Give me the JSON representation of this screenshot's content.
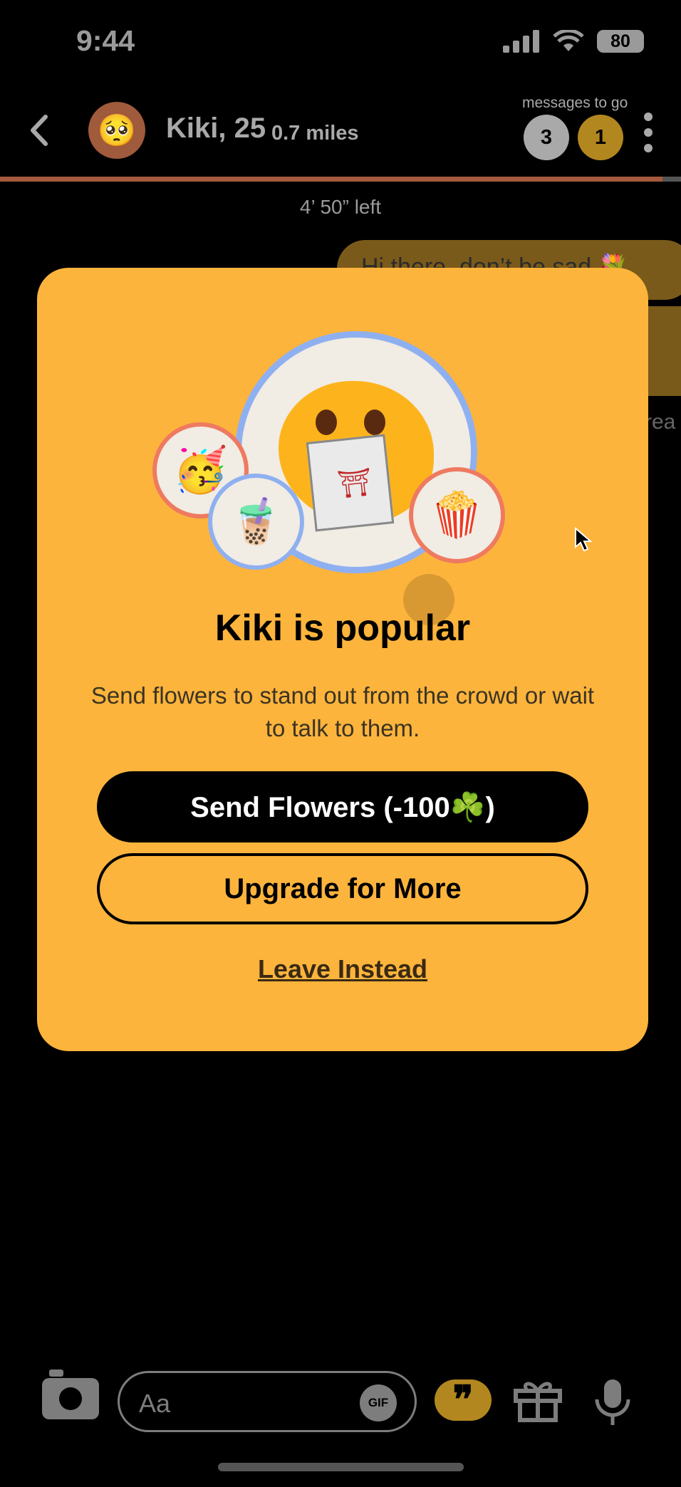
{
  "status_bar": {
    "time": "9:44",
    "battery": "80"
  },
  "header": {
    "name": "Kiki, 25",
    "distance": "0.7 miles",
    "messages_to_go_label": "messages to go",
    "badge_a": "3",
    "badge_b": "1",
    "timer_text": "4’ 50” left"
  },
  "chat": {
    "bubble_text": "Hi there, don’t be sad 💐",
    "read_text": "rea"
  },
  "modal": {
    "title": "Kiki is popular",
    "description": "Send flowers to stand out from the crowd or wait to talk to them.",
    "send_flowers_label": "Send Flowers (-100☘️)",
    "upgrade_label": "Upgrade for More",
    "leave_label": "Leave Instead"
  },
  "composer": {
    "placeholder": "Aa",
    "gif_label": "GIF",
    "quote_glyph": "❞"
  }
}
